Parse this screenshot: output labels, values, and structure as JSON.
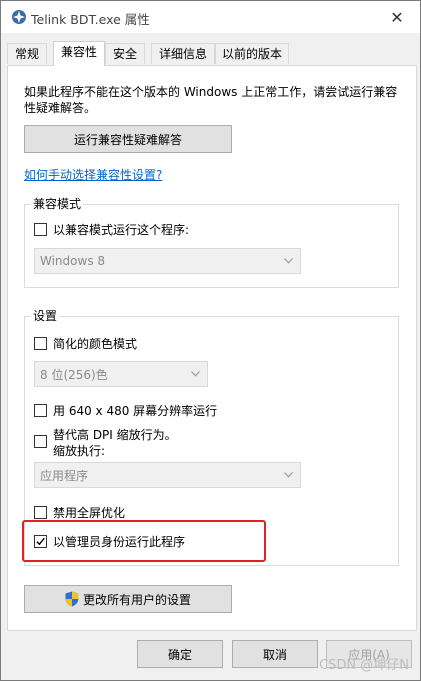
{
  "window": {
    "title": "Telink BDT.exe 属性",
    "close_glyph": "✕"
  },
  "tabs": [
    {
      "label": "常规",
      "active": false
    },
    {
      "label": "兼容性",
      "active": true
    },
    {
      "label": "安全",
      "active": false
    },
    {
      "label": "详细信息",
      "active": false
    },
    {
      "label": "以前的版本",
      "active": false
    }
  ],
  "compat": {
    "description": "如果此程序不能在这个版本的 Windows 上正常工作，请尝试运行兼容性疑难解答。",
    "troubleshoot_button": "运行兼容性疑难解答",
    "manual_link": "如何手动选择兼容性设置?"
  },
  "compat_mode": {
    "group_label": "兼容模式",
    "checkbox_label": "以兼容模式运行这个程序:",
    "checked": false,
    "select_value": "Windows 8"
  },
  "settings": {
    "group_label": "设置",
    "reduced_color": {
      "label": "简化的颜色模式",
      "checked": false
    },
    "color_select": "8 位(256)色",
    "res_640": {
      "label": "用 640 x 480 屏幕分辨率运行",
      "checked": false
    },
    "dpi_override": {
      "label_line1": "替代高 DPI 缩放行为。",
      "label_line2": "缩放执行:",
      "checked": false
    },
    "dpi_select": "应用程序",
    "disable_fullscreen": {
      "label": "禁用全屏优化",
      "checked": false
    },
    "run_as_admin": {
      "label": "以管理员身份运行此程序",
      "checked": true
    }
  },
  "all_users_button": "更改所有用户的设置",
  "footer": {
    "ok": "确定",
    "cancel": "取消",
    "apply": "应用(A)"
  },
  "watermark": "CSDN @坤仔N",
  "colors": {
    "highlight": "#e3202a",
    "link": "#0066cc",
    "shield_blue": "#2f6fd6",
    "shield_yellow": "#f2c31b"
  }
}
